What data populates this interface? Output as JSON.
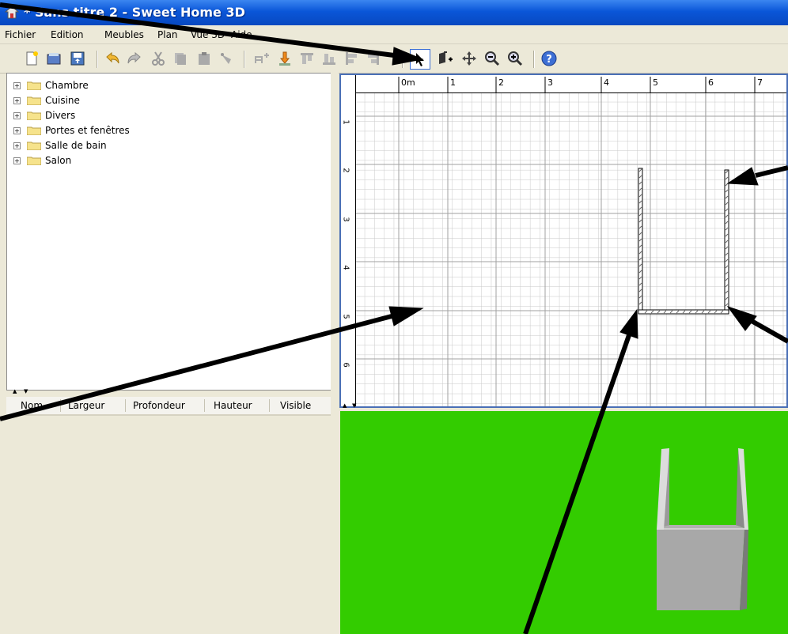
{
  "window": {
    "title": "* Sans titre 2 - Sweet Home 3D",
    "app_icon": "sweet-home-3d-icon",
    "title_color": "#0a56d8"
  },
  "menu": {
    "items": [
      "Fichier",
      "Edition",
      "Meubles",
      "Plan",
      "Vue 3D",
      "Aide"
    ]
  },
  "toolbar": {
    "buttons": [
      {
        "icon": "new-file-icon"
      },
      {
        "icon": "open-folder-icon"
      },
      {
        "icon": "save-icon"
      },
      {
        "icon": "undo-icon"
      },
      {
        "icon": "redo-icon"
      },
      {
        "icon": "cut-icon"
      },
      {
        "icon": "copy-icon"
      },
      {
        "icon": "paste-icon"
      },
      {
        "icon": "delete-icon"
      },
      {
        "icon": "add-furniture-icon"
      },
      {
        "icon": "import-furniture-icon"
      },
      {
        "icon": "align-top-icon"
      },
      {
        "icon": "align-bottom-icon"
      },
      {
        "icon": "align-left-icon"
      },
      {
        "icon": "align-right-icon"
      },
      {
        "icon": "select-mode-icon",
        "pressed": true
      },
      {
        "icon": "create-walls-icon"
      },
      {
        "icon": "pan-icon"
      },
      {
        "icon": "zoom-out-icon"
      },
      {
        "icon": "zoom-in-icon"
      },
      {
        "icon": "help-icon"
      }
    ]
  },
  "catalog": {
    "categories": [
      "Chambre",
      "Cuisine",
      "Divers",
      "Portes et fenêtres",
      "Salle de bain",
      "Salon"
    ]
  },
  "furniture_table": {
    "columns": [
      "Nom",
      "Largeur",
      "Profondeur",
      "Hauteur",
      "Visible"
    ]
  },
  "plan": {
    "ruler_top": [
      "0m",
      "1",
      "2",
      "3",
      "4",
      "5",
      "6",
      "7"
    ],
    "ruler_left": [
      "1",
      "2",
      "3",
      "4",
      "5",
      "6"
    ]
  },
  "view3d": {
    "ground_color": "#33cc00",
    "wall_color": "#a0a0a0"
  }
}
